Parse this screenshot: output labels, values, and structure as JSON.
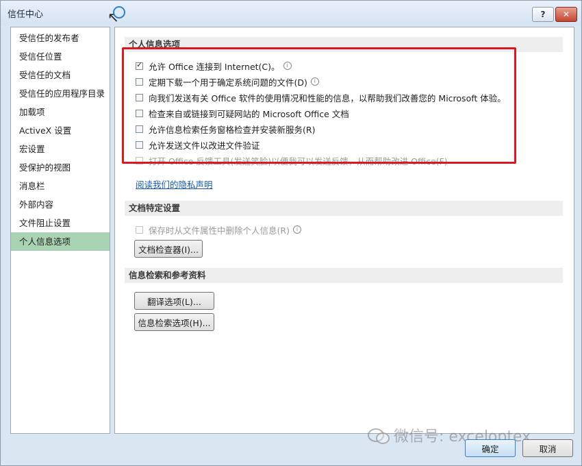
{
  "window": {
    "title": "信任中心"
  },
  "sidebar": {
    "items": [
      {
        "label": "受信任的发布者"
      },
      {
        "label": "受信任位置"
      },
      {
        "label": "受信任的文档"
      },
      {
        "label": "受信任的应用程序目录"
      },
      {
        "label": "加载项"
      },
      {
        "label": "ActiveX 设置"
      },
      {
        "label": "宏设置"
      },
      {
        "label": "受保护的视图"
      },
      {
        "label": "消息栏"
      },
      {
        "label": "外部内容"
      },
      {
        "label": "文件阻止设置"
      },
      {
        "label": "个人信息选项",
        "selected": true
      }
    ]
  },
  "privacy": {
    "header": "个人信息选项",
    "options": [
      {
        "label": "允许 Office 连接到 Internet(C)。",
        "checked": true,
        "enabled": true,
        "info": true
      },
      {
        "label": "定期下载一个用于确定系统问题的文件(D)",
        "checked": false,
        "enabled": true,
        "info": true
      },
      {
        "label": "向我们发送有关 Office 软件的使用情况和性能的信息，以帮助我们改善您的 Microsoft 体验。",
        "checked": false,
        "enabled": true,
        "info": false
      },
      {
        "label": "检查来自或链接到可疑网站的 Microsoft Office 文档",
        "checked": false,
        "enabled": true,
        "info": false
      },
      {
        "label": "允许信息检索任务窗格检查并安装新服务(R)",
        "checked": false,
        "enabled": true,
        "info": false
      },
      {
        "label": "允许发送文件以改进文件验证",
        "checked": false,
        "enabled": true,
        "info": false
      },
      {
        "label": "打开 Office 反馈工具(发送笑脸)以便我可以发送反馈，从而帮助改进 Office(F)",
        "checked": false,
        "enabled": false,
        "info": false
      }
    ],
    "privacy_link": "阅读我们的隐私声明"
  },
  "doc_settings": {
    "header": "文档特定设置",
    "option": {
      "label": "保存时从文件属性中删除个人信息(R)",
      "checked": false,
      "enabled": false,
      "info": true
    },
    "inspector_button": "文档检查器(I)..."
  },
  "research": {
    "header": "信息检索和参考资料",
    "translate_button": "翻译选项(L)...",
    "research_button": "信息检索选项(H)..."
  },
  "footer": {
    "ok": "确定",
    "cancel": "取消"
  },
  "watermark": "微信号: exceloptex",
  "colors": {
    "highlight_box": "#d71920",
    "selected_nav": "#a9d3b3",
    "link": "#1a5aa6"
  }
}
